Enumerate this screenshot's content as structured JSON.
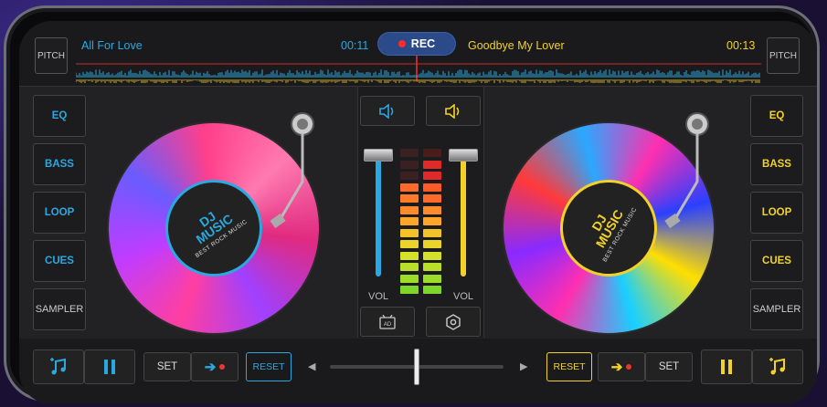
{
  "top": {
    "pitch_left": "PITCH",
    "pitch_right": "PITCH",
    "track_left": {
      "name": "All For Love",
      "time": "00:11"
    },
    "track_right": {
      "name": "Goodbye My Lover",
      "time": "00:13"
    },
    "rec_label": "REC"
  },
  "left_buttons": [
    "EQ",
    "BASS",
    "LOOP",
    "CUES",
    "SAMPLER"
  ],
  "right_buttons": [
    "EQ",
    "BASS",
    "LOOP",
    "CUES",
    "SAMPLER"
  ],
  "deck_label": {
    "title": "DJ\nMUSIC",
    "subtitle": "BEST ROCK MUSIC"
  },
  "mixer": {
    "vol_left": "VOL",
    "vol_right": "VOL"
  },
  "bottom": {
    "set_left": "SET",
    "reset_left": "RESET",
    "reset_right": "RESET",
    "set_right": "SET"
  },
  "colors": {
    "left_accent": "#2aa8e0",
    "right_accent": "#f2d22a",
    "rec_bg": "#2a4a8a"
  },
  "icons": [
    "music-note-icon",
    "pause-icon",
    "arrow-right-icon",
    "record-dot-icon",
    "speaker-icon",
    "ad-tv-icon",
    "hexagon-icon",
    "chevron-left-icon",
    "chevron-right-icon"
  ]
}
